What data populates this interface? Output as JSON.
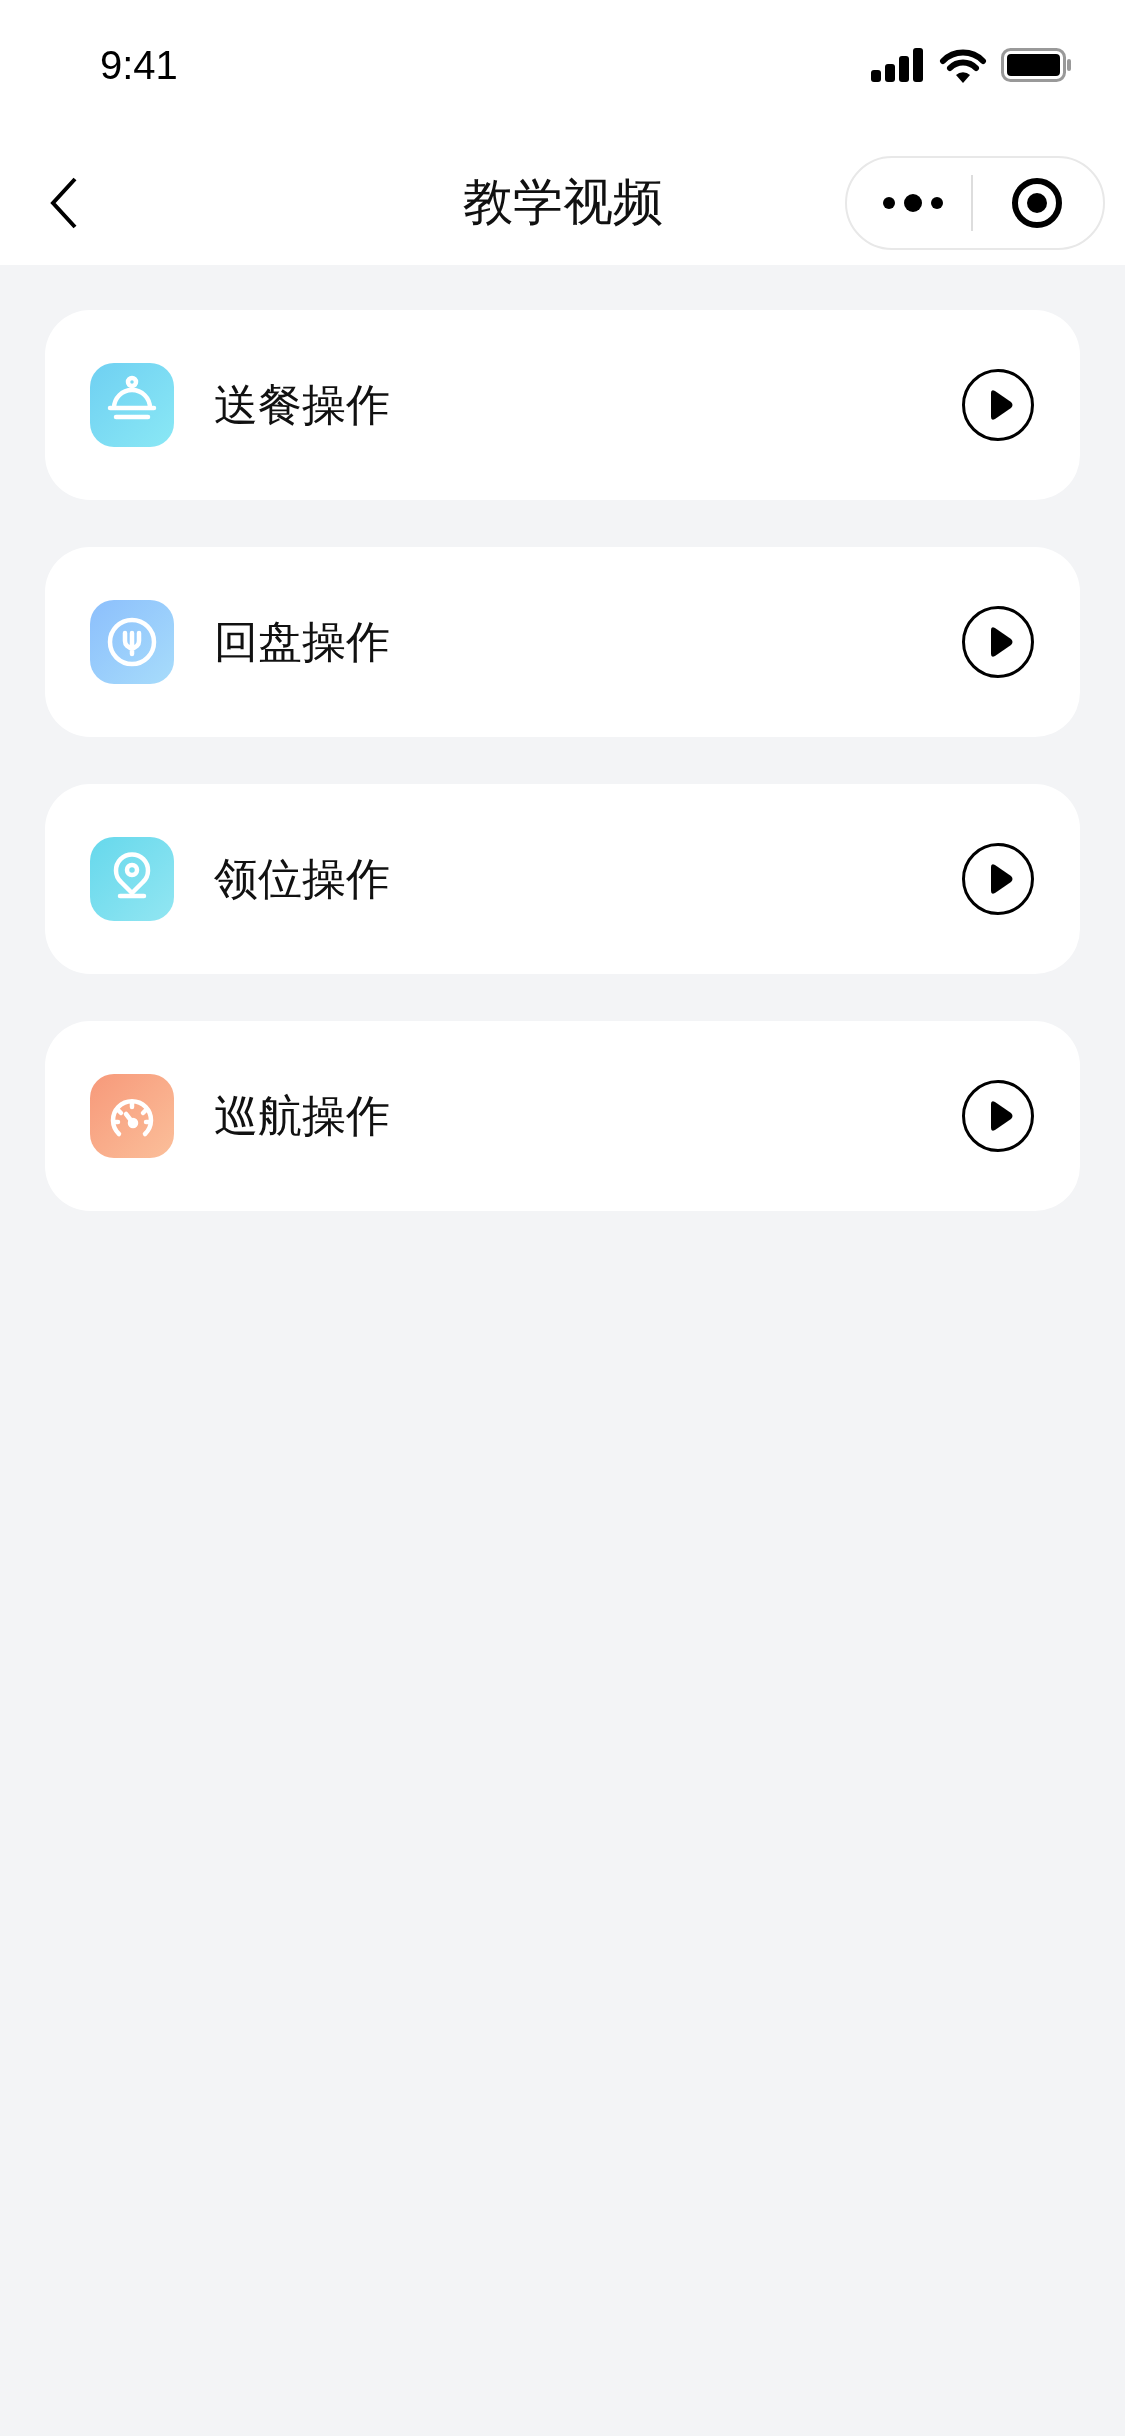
{
  "status_bar": {
    "time": "9:41"
  },
  "nav_bar": {
    "title": "教学视频"
  },
  "items": [
    {
      "kind": "cloche",
      "label": "送餐操作"
    },
    {
      "kind": "plate",
      "label": "回盘操作"
    },
    {
      "kind": "pin",
      "label": "领位操作"
    },
    {
      "kind": "gauge",
      "label": "巡航操作"
    }
  ]
}
